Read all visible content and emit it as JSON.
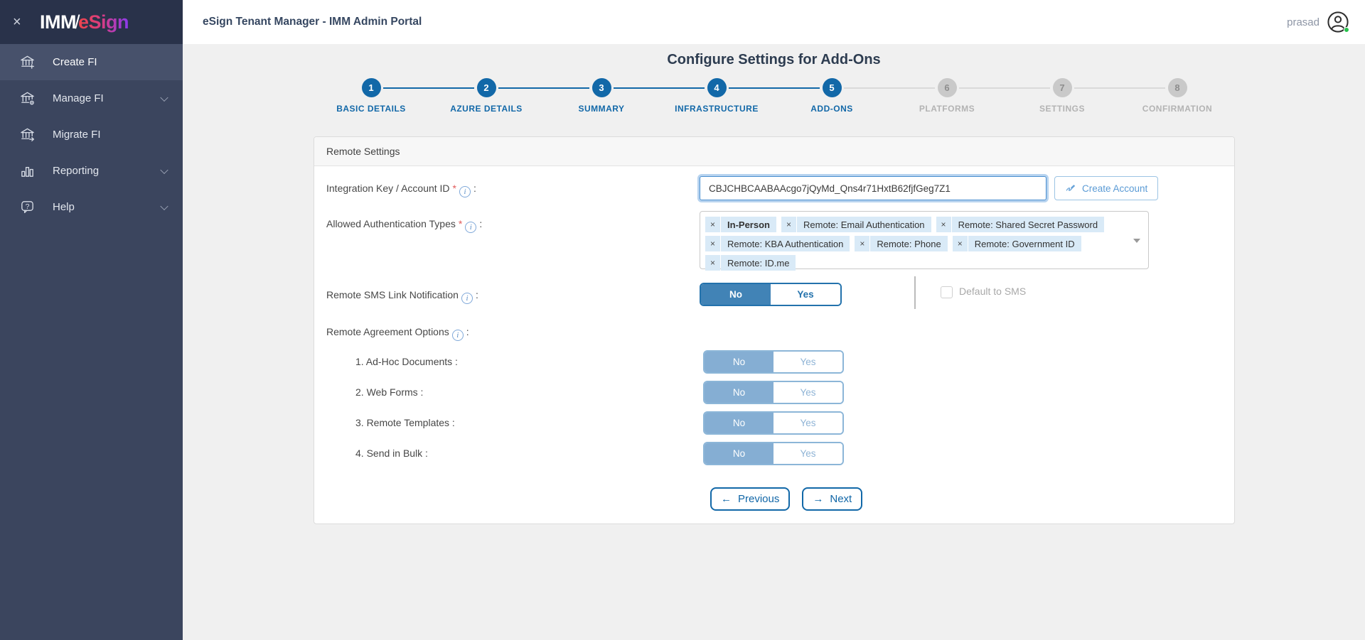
{
  "ui": {
    "close_glyph": "×",
    "required_marker": "*",
    "info_glyph": "i",
    "colon": ":",
    "tag_remove_glyph": "×"
  },
  "sidebar": {
    "logo": {
      "imm": "IMM",
      "slash": "/",
      "esign": "eSign"
    },
    "items": [
      {
        "label": "Create FI",
        "icon": "bank-plus",
        "active": true,
        "chevron": false
      },
      {
        "label": "Manage FI",
        "icon": "bank-gear",
        "active": false,
        "chevron": true
      },
      {
        "label": "Migrate FI",
        "icon": "bank-arrow",
        "active": false,
        "chevron": false
      },
      {
        "label": "Reporting",
        "icon": "bar-chart",
        "active": false,
        "chevron": true
      },
      {
        "label": "Help",
        "icon": "help-bubble",
        "active": false,
        "chevron": true
      }
    ]
  },
  "header": {
    "title": "eSign Tenant Manager - IMM Admin Portal",
    "username": "prasad"
  },
  "main": {
    "page_title": "Configure Settings for Add-Ons",
    "stepper": [
      {
        "number": "1",
        "label": "BASIC DETAILS",
        "state": "done"
      },
      {
        "number": "2",
        "label": "AZURE DETAILS",
        "state": "done"
      },
      {
        "number": "3",
        "label": "SUMMARY",
        "state": "done"
      },
      {
        "number": "4",
        "label": "INFRASTRUCTURE",
        "state": "done"
      },
      {
        "number": "5",
        "label": "ADD-ONS",
        "state": "active"
      },
      {
        "number": "6",
        "label": "PLATFORMS",
        "state": "pending"
      },
      {
        "number": "7",
        "label": "SETTINGS",
        "state": "pending"
      },
      {
        "number": "8",
        "label": "CONFIRMATION",
        "state": "pending"
      }
    ],
    "panel": {
      "title": "Remote Settings",
      "integration_key": {
        "label": "Integration Key / Account ID",
        "value": "CBJCHBCAABAAcgo7jQyMd_Qns4r71HxtB62fjfGeg7Z1",
        "create_account_label": "Create Account"
      },
      "auth_types": {
        "label": "Allowed Authentication Types",
        "tags": [
          "In-Person",
          "Remote: Email Authentication",
          "Remote: Shared Secret Password",
          "Remote: KBA Authentication",
          "Remote: Phone",
          "Remote: Government ID",
          "Remote: ID.me"
        ]
      },
      "sms_notification": {
        "label": "Remote SMS Link Notification",
        "no_label": "No",
        "yes_label": "Yes",
        "selected": "No",
        "default_to_sms_label": "Default to SMS",
        "default_to_sms_checked": false
      },
      "agreement_options": {
        "label": "Remote Agreement Options",
        "options": [
          {
            "label": "1. Ad-Hoc Documents :",
            "no_label": "No",
            "yes_label": "Yes",
            "selected": "No"
          },
          {
            "label": "2. Web Forms :",
            "no_label": "No",
            "yes_label": "Yes",
            "selected": "No"
          },
          {
            "label": "3. Remote Templates :",
            "no_label": "No",
            "yes_label": "Yes",
            "selected": "No"
          },
          {
            "label": "4. Send in Bulk :",
            "no_label": "No",
            "yes_label": "Yes",
            "selected": "No"
          }
        ]
      },
      "previous_button": {
        "icon": "←",
        "label": "Previous"
      },
      "next_button": {
        "icon": "→",
        "label": "Next"
      }
    }
  },
  "colors": {
    "accent_blue": "#1268a8",
    "toggle_selected_blue": "#4183b6",
    "toggle_light_blue": "#85aed3",
    "sidebar_bg": "#3b455e",
    "sidebar_header_bg": "#29324a",
    "logo_gradient_start": "#ef4549",
    "logo_gradient_end": "#8a3bee",
    "tag_bg": "#d9eaf7",
    "status_green": "#27c24c",
    "input_focus_border": "#4a8fd0"
  }
}
